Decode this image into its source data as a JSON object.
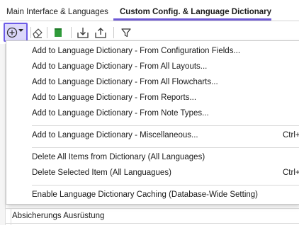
{
  "tabs": [
    {
      "label": "Main Interface & Languages"
    },
    {
      "label": "Custom Config. & Language Dictionary"
    }
  ],
  "accent_color": "#6d5ce8",
  "toolbar": {
    "buttons": [
      {
        "icon": "add-dropdown-icon"
      },
      {
        "icon": "eraser-icon"
      },
      {
        "icon": "green-square-icon"
      },
      {
        "icon": "import-icon"
      },
      {
        "icon": "export-icon"
      },
      {
        "icon": "filter-icon"
      }
    ]
  },
  "menu": {
    "groups": [
      [
        {
          "label": "Add to Language Dictionary - From Configuration Fields..."
        },
        {
          "label": "Add to Language Dictionary - From All Layouts..."
        },
        {
          "label": "Add to Language Dictionary - From All Flowcharts..."
        },
        {
          "label": "Add to Language Dictionary - From Reports..."
        },
        {
          "label": "Add to Language Dictionary - From Note Types..."
        }
      ],
      [
        {
          "label": "Add to Language Dictionary - Miscellaneous...",
          "shortcut": "Ctrl+"
        }
      ],
      [
        {
          "label": "Delete All Items from Dictionary (All Languages)"
        },
        {
          "label": "Delete Selected Item (All Languagues)",
          "shortcut": "Ctrl+"
        }
      ],
      [
        {
          "label": "Enable Language Dictionary Caching (Database-Wide Setting)"
        }
      ]
    ]
  },
  "background_row": {
    "label": "Absicherungs Ausrüstung"
  }
}
